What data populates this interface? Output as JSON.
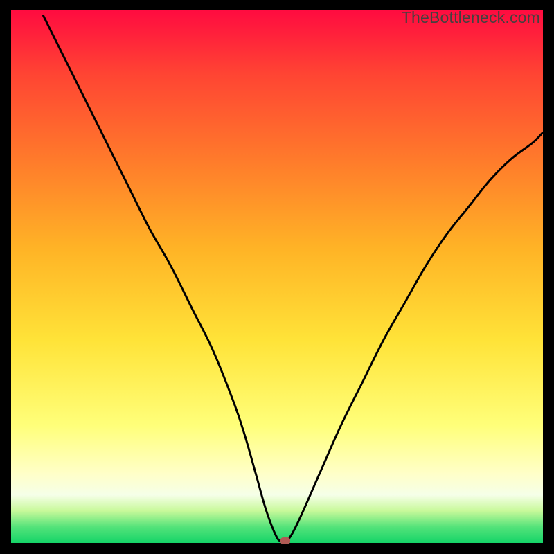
{
  "watermark": "TheBottleneck.com",
  "colors": {
    "curve_stroke": "#000000",
    "marker_fill": "#b15a55"
  },
  "chart_data": {
    "type": "line",
    "title": "",
    "xlabel": "",
    "ylabel": "",
    "xlim": [
      0,
      100
    ],
    "ylim": [
      0,
      100
    ],
    "grid": false,
    "series": [
      {
        "name": "bottleneck-curve",
        "x": [
          6,
          10,
          14,
          18,
          22,
          26,
          30,
          34,
          38,
          42,
          44,
          46,
          48,
          50,
          51,
          52,
          54,
          58,
          62,
          66,
          70,
          74,
          78,
          82,
          86,
          90,
          94,
          98,
          100
        ],
        "y": [
          99,
          91,
          83,
          75,
          67,
          59,
          52,
          44,
          36,
          26,
          20,
          13,
          6,
          1,
          0.5,
          0.5,
          4,
          13,
          22,
          30,
          38,
          45,
          52,
          58,
          63,
          68,
          72,
          75,
          77
        ]
      }
    ],
    "marker": {
      "x": 51.5,
      "y": 0.4
    }
  }
}
